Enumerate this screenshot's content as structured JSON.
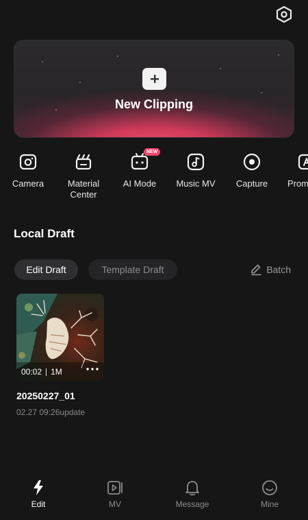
{
  "header": {
    "settings_icon": "settings-hex-icon"
  },
  "hero": {
    "label": "New Clipping",
    "icon": "plus-icon"
  },
  "tools": [
    {
      "label": "Camera",
      "icon": "camera-icon"
    },
    {
      "label": "Material\nCenter",
      "icon": "clapperboard-icon"
    },
    {
      "label": "AI Mode",
      "icon": "robot-icon",
      "badge": "NEW"
    },
    {
      "label": "Music MV",
      "icon": "music-note-icon"
    },
    {
      "label": "Capture",
      "icon": "record-icon"
    },
    {
      "label": "Prom",
      "icon": "prompt-icon"
    }
  ],
  "local_draft": {
    "title": "Local Draft",
    "tabs": {
      "edit": "Edit Draft",
      "template": "Template Draft"
    },
    "batch_label": "Batch",
    "drafts": [
      {
        "duration": "00:02",
        "size": "1M",
        "name": "20250227_01",
        "date": "02.27 09:26update"
      }
    ]
  },
  "tabbar": {
    "items": [
      {
        "label": "Edit",
        "icon": "lightning-icon",
        "active": true
      },
      {
        "label": "MV",
        "icon": "video-play-icon",
        "active": false
      },
      {
        "label": "Message",
        "icon": "bell-icon",
        "active": false
      },
      {
        "label": "Mine",
        "icon": "smiley-face-icon",
        "active": false
      }
    ]
  },
  "colors": {
    "background": "#161616",
    "accent": "#f0456a",
    "hero_glow": "#f0506e"
  }
}
